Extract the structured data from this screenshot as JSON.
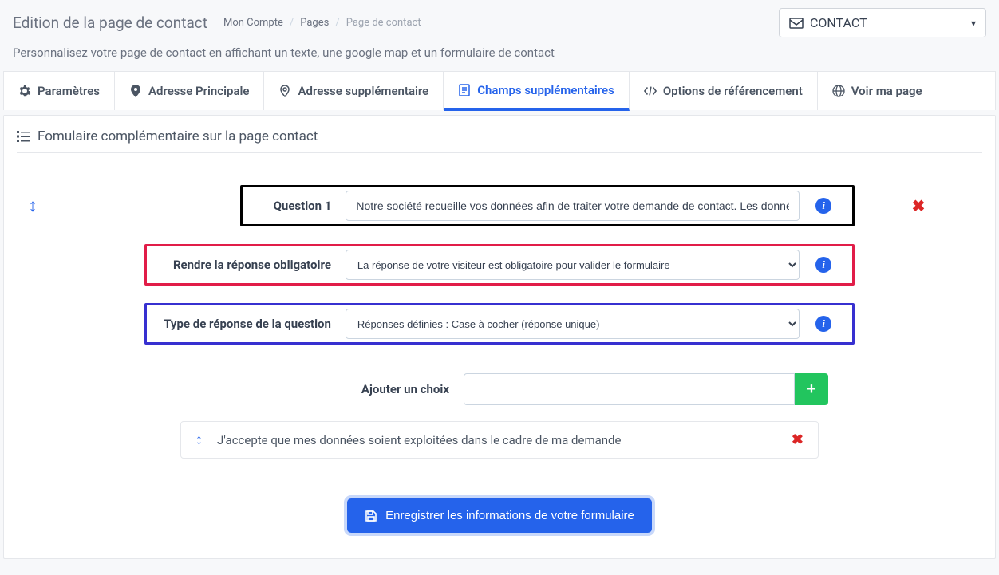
{
  "header": {
    "title": "Edition de la page de contact",
    "breadcrumb": [
      "Mon Compte",
      "Pages",
      "Page de contact"
    ],
    "contact_dropdown": "CONTACT"
  },
  "subtitle": "Personnalisez votre page de contact en affichant un texte, une google map et un formulaire de contact",
  "tabs": [
    {
      "icon": "gear-icon",
      "label": "Paramètres"
    },
    {
      "icon": "map-pin-icon",
      "label": "Adresse Principale"
    },
    {
      "icon": "map-pin-outline-icon",
      "label": "Adresse supplémentaire"
    },
    {
      "icon": "form-icon",
      "label": "Champs supplémentaires",
      "active": true
    },
    {
      "icon": "code-icon",
      "label": "Options de référencement"
    },
    {
      "icon": "globe-icon",
      "label": "Voir ma page"
    }
  ],
  "card": {
    "title": "Fomulaire complémentaire sur la page contact",
    "question": {
      "label": "Question 1",
      "value": "Notre société recueille vos données afin de traiter votre demande de contact. Les données re"
    },
    "required": {
      "label": "Rendre la réponse obligatoire",
      "selected": "La réponse de votre visiteur est obligatoire pour valider le formulaire"
    },
    "response_type": {
      "label": "Type de réponse de la question",
      "selected": "Réponses définies : Case à cocher (réponse unique)"
    },
    "add_choice": {
      "label": "Ajouter un choix",
      "value": ""
    },
    "choices": [
      {
        "text": "J'accepte que mes données soient exploitées dans le cadre de ma demande"
      }
    ],
    "save_button": "Enregistrer les informations de votre formulaire"
  }
}
